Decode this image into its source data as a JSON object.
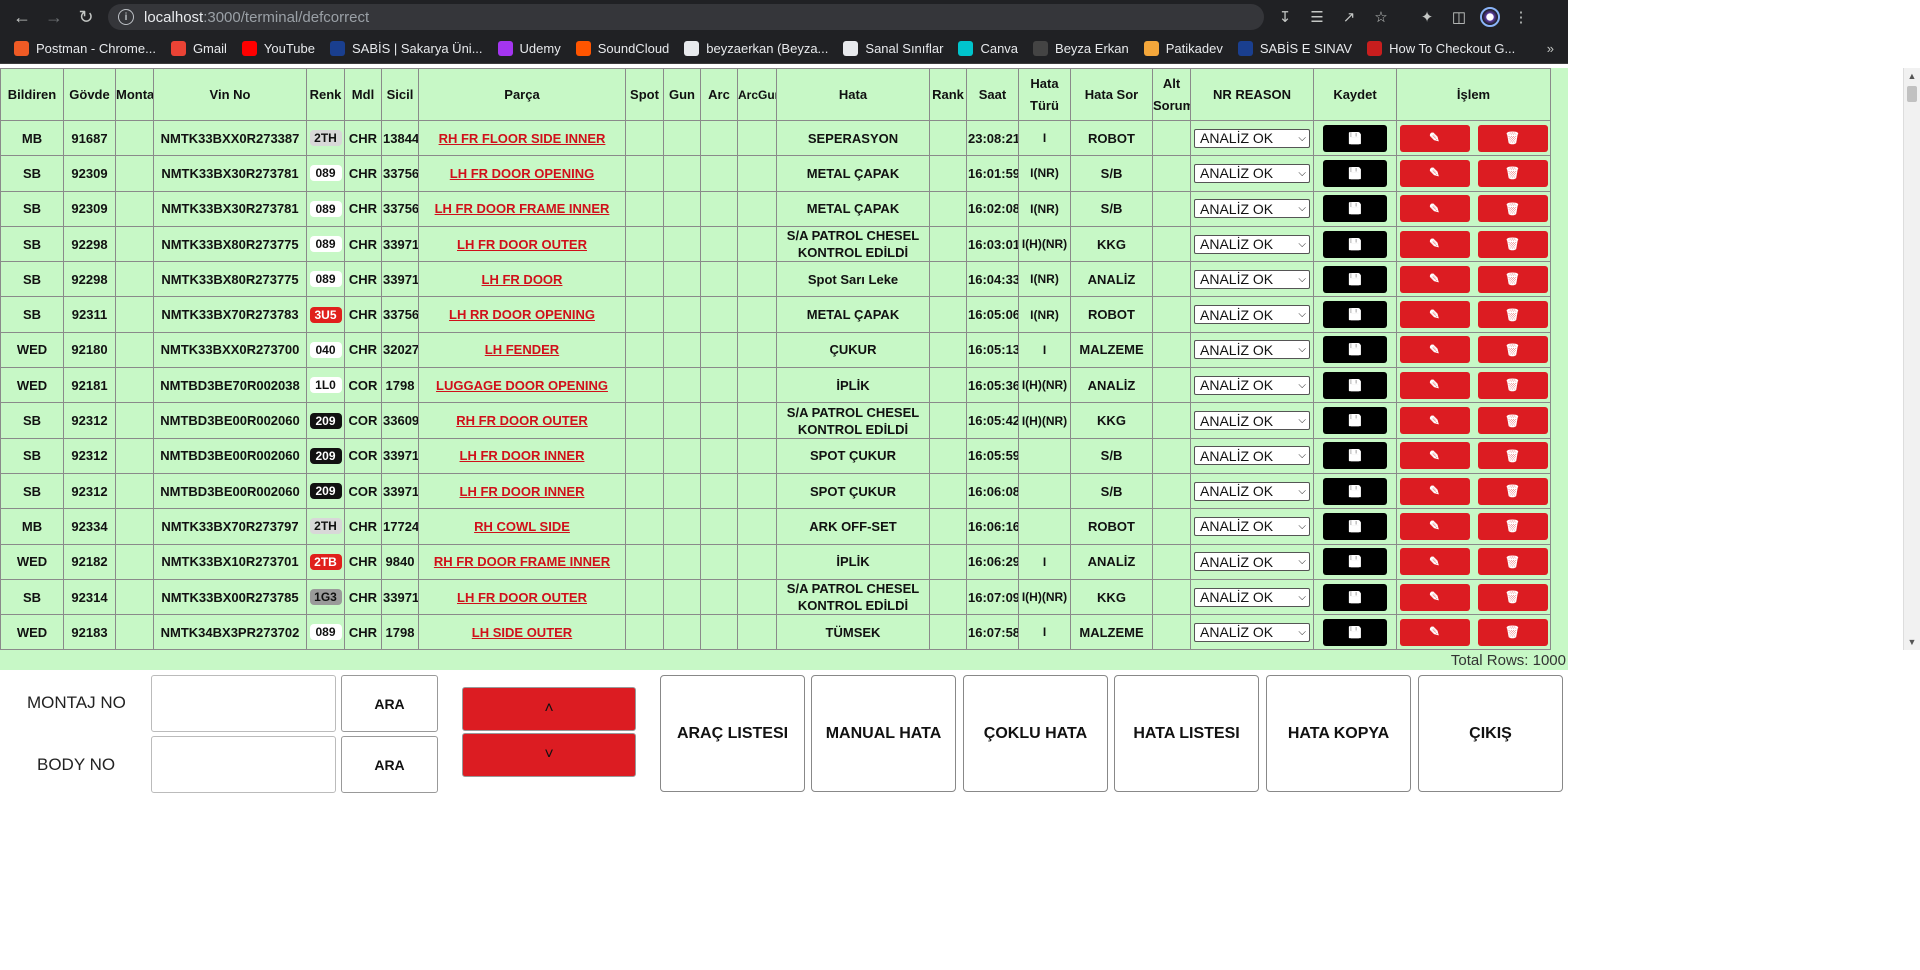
{
  "browser": {
    "url_host": "localhost",
    "url_path": ":3000/terminal/defcorrect",
    "bookmarks": [
      {
        "label": "Postman - Chrome...",
        "color": "#ef5b25"
      },
      {
        "label": "Gmail",
        "color": "#ea4335"
      },
      {
        "label": "YouTube",
        "color": "#ff0000"
      },
      {
        "label": "SABİS | Sakarya Üni...",
        "color": "#1a3f8f"
      },
      {
        "label": "Udemy",
        "color": "#a435f0"
      },
      {
        "label": "SoundCloud",
        "color": "#ff5500"
      },
      {
        "label": "beyzaerkan (Beyza...",
        "color": "#e8eaed"
      },
      {
        "label": "Sanal Sınıflar",
        "color": "#e8eaed"
      },
      {
        "label": "Canva",
        "color": "#00c4cc"
      },
      {
        "label": "Beyza Erkan",
        "color": "#444444"
      },
      {
        "label": "Patikadev",
        "color": "#f4a73b"
      },
      {
        "label": "SABİS E SINAV",
        "color": "#1a3f8f"
      },
      {
        "label": "How To Checkout G...",
        "color": "#c81e1e"
      }
    ]
  },
  "table": {
    "headers": {
      "bildiren": "Bildiren",
      "govde": "Gövde",
      "montaj": "Montaj",
      "vin": "Vin No",
      "renk": "Renk",
      "mdl": "Mdl",
      "sicil": "Sicil",
      "parca": "Parça",
      "spot": "Spot",
      "gun": "Gun",
      "arc": "Arc",
      "arcgun": "ArcGun",
      "hata": "Hata",
      "rank": "Rank",
      "saat": "Saat",
      "hata_turu": "Hata Türü",
      "hata_sor": "Hata Sor",
      "alt_sorumlu": "Alt Sorumlu",
      "nr_reason": "NR REASON",
      "kaydet": "Kaydet",
      "islem": "İşlem"
    },
    "select_value": "ANALİZ OK",
    "rows": [
      {
        "bildiren": "MB",
        "govde": "91687",
        "vin": "NMTK33BXX0R273387",
        "renk": "2TH",
        "renk_style": "gray",
        "mdl": "CHR",
        "sicil": "13844",
        "parca": "RH FR FLOOR SIDE INNER",
        "hata": "SEPERASYON",
        "hata2": "",
        "saat": "23:08:21",
        "hata_turu": "I",
        "hata_sor": "ROBOT"
      },
      {
        "bildiren": "SB",
        "govde": "92309",
        "vin": "NMTK33BX30R273781",
        "renk": "089",
        "renk_style": "white",
        "mdl": "CHR",
        "sicil": "33756",
        "parca": "LH FR DOOR OPENING",
        "hata": "METAL ÇAPAK",
        "hata2": "",
        "saat": "16:01:59",
        "hata_turu": "I(NR)",
        "hata_sor": "S/B"
      },
      {
        "bildiren": "SB",
        "govde": "92309",
        "vin": "NMTK33BX30R273781",
        "renk": "089",
        "renk_style": "white",
        "mdl": "CHR",
        "sicil": "33756",
        "parca": "LH FR DOOR FRAME INNER",
        "hata": "METAL ÇAPAK",
        "hata2": "",
        "saat": "16:02:08",
        "hata_turu": "I(NR)",
        "hata_sor": "S/B"
      },
      {
        "bildiren": "SB",
        "govde": "92298",
        "vin": "NMTK33BX80R273775",
        "renk": "089",
        "renk_style": "white",
        "mdl": "CHR",
        "sicil": "33971",
        "parca": "LH FR DOOR OUTER",
        "hata": "S/A PATROL CHESEL",
        "hata2": "KONTROL EDİLDİ",
        "saat": "16:03:01",
        "hata_turu": "I(H)(NR)",
        "hata_sor": "KKG"
      },
      {
        "bildiren": "SB",
        "govde": "92298",
        "vin": "NMTK33BX80R273775",
        "renk": "089",
        "renk_style": "white",
        "mdl": "CHR",
        "sicil": "33971",
        "parca": "LH FR DOOR",
        "hata": "Spot Sarı Leke",
        "hata2": "",
        "saat": "16:04:33",
        "hata_turu": "I(NR)",
        "hata_sor": "ANALİZ"
      },
      {
        "bildiren": "SB",
        "govde": "92311",
        "vin": "NMTK33BX70R273783",
        "renk": "3U5",
        "renk_style": "red",
        "mdl": "CHR",
        "sicil": "33756",
        "parca": "LH RR DOOR OPENING",
        "hata": "METAL ÇAPAK",
        "hata2": "",
        "saat": "16:05:06",
        "hata_turu": "I(NR)",
        "hata_sor": "ROBOT"
      },
      {
        "bildiren": "WED",
        "govde": "92180",
        "vin": "NMTK33BXX0R273700",
        "renk": "040",
        "renk_style": "white",
        "mdl": "CHR",
        "sicil": "32027",
        "parca": "LH FENDER",
        "hata": "ÇUKUR",
        "hata2": "",
        "saat": "16:05:13",
        "hata_turu": "I",
        "hata_sor": "MALZEME"
      },
      {
        "bildiren": "WED",
        "govde": "92181",
        "vin": "NMTBD3BE70R002038",
        "renk": "1L0",
        "renk_style": "white",
        "mdl": "COR",
        "sicil": "1798",
        "parca": "LUGGAGE DOOR OPENING",
        "hata": "İPLİK",
        "hata2": "",
        "saat": "16:05:36",
        "hata_turu": "I(H)(NR)",
        "hata_sor": "ANALİZ"
      },
      {
        "bildiren": "SB",
        "govde": "92312",
        "vin": "NMTBD3BE00R002060",
        "renk": "209",
        "renk_style": "black",
        "mdl": "COR",
        "sicil": "33609",
        "parca": "RH FR DOOR OUTER",
        "hata": "S/A PATROL CHESEL",
        "hata2": "KONTROL EDİLDİ",
        "saat": "16:05:42",
        "hata_turu": "I(H)(NR)",
        "hata_sor": "KKG"
      },
      {
        "bildiren": "SB",
        "govde": "92312",
        "vin": "NMTBD3BE00R002060",
        "renk": "209",
        "renk_style": "black",
        "mdl": "COR",
        "sicil": "33971",
        "parca": "LH FR DOOR INNER",
        "hata": "SPOT ÇUKUR",
        "hata2": "",
        "saat": "16:05:59",
        "hata_turu": "",
        "hata_sor": "S/B"
      },
      {
        "bildiren": "SB",
        "govde": "92312",
        "vin": "NMTBD3BE00R002060",
        "renk": "209",
        "renk_style": "black",
        "mdl": "COR",
        "sicil": "33971",
        "parca": "LH FR DOOR INNER",
        "hata": "SPOT ÇUKUR",
        "hata2": "",
        "saat": "16:06:08",
        "hata_turu": "",
        "hata_sor": "S/B"
      },
      {
        "bildiren": "MB",
        "govde": "92334",
        "vin": "NMTK33BX70R273797",
        "renk": "2TH",
        "renk_style": "gray",
        "mdl": "CHR",
        "sicil": "17724",
        "parca": "RH COWL SIDE",
        "hata": "ARK OFF-SET",
        "hata2": "",
        "saat": "16:06:16",
        "hata_turu": "",
        "hata_sor": "ROBOT"
      },
      {
        "bildiren": "WED",
        "govde": "92182",
        "vin": "NMTK33BX10R273701",
        "renk": "2TB",
        "renk_style": "red",
        "mdl": "CHR",
        "sicil": "9840",
        "parca": "RH FR DOOR FRAME INNER",
        "hata": "İPLİK",
        "hata2": "",
        "saat": "16:06:29",
        "hata_turu": "I",
        "hata_sor": "ANALİZ"
      },
      {
        "bildiren": "SB",
        "govde": "92314",
        "vin": "NMTK33BX00R273785",
        "renk": "1G3",
        "renk_style": "darkgray",
        "mdl": "CHR",
        "sicil": "33971",
        "parca": "LH FR DOOR OUTER",
        "hata": "S/A PATROL CHESEL",
        "hata2": "KONTROL EDİLDİ",
        "saat": "16:07:09",
        "hata_turu": "I(H)(NR)",
        "hata_sor": "KKG"
      },
      {
        "bildiren": "WED",
        "govde": "92183",
        "vin": "NMTK34BX3PR273702",
        "renk": "089",
        "renk_style": "white",
        "mdl": "CHR",
        "sicil": "1798",
        "parca": "LH SIDE OUTER",
        "hata": "TÜMSEK",
        "hata2": "",
        "saat": "16:07:58",
        "hata_turu": "I",
        "hata_sor": "MALZEME"
      }
    ],
    "total_rows": "Total Rows: 1000"
  },
  "bottom": {
    "montaj_label": "MONTAJ NO",
    "body_label": "BODY NO",
    "ara1": "ARA",
    "ara2": "ARA",
    "buttons": [
      "ARAÇ LISTESI",
      "MANUAL HATA",
      "ÇOKLU HATA",
      "HATA LISTESI",
      "HATA KOPYA",
      "ÇIKIŞ"
    ]
  },
  "colors": {
    "table_bg": "#c7f8c6",
    "accent_red": "#dc1c22",
    "part_link": "#d0101a"
  }
}
